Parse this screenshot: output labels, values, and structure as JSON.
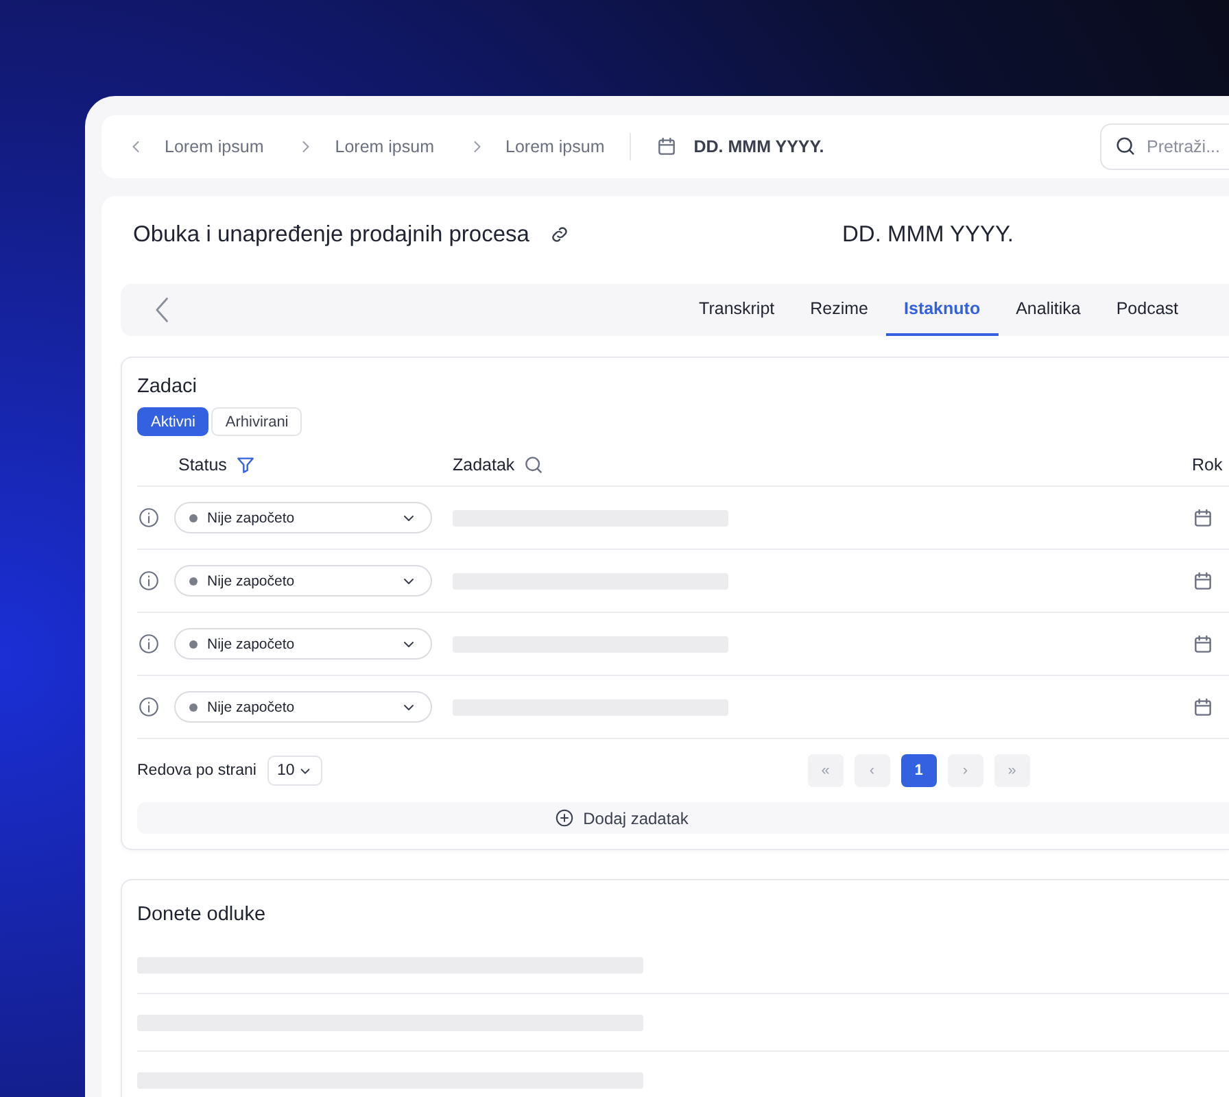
{
  "breadcrumbs": [
    {
      "label": "Lorem ipsum"
    },
    {
      "label": "Lorem ipsum"
    },
    {
      "label": "Lorem ipsum"
    }
  ],
  "breadcrumb_date": "DD. MMM YYYY.",
  "search": {
    "placeholder": "Pretraži..."
  },
  "page": {
    "title": "Obuka i unapređenje prodajnih procesa",
    "date": "DD. MMM YYYY."
  },
  "tabs": [
    {
      "label": "Transkript",
      "selected": false
    },
    {
      "label": "Rezime",
      "selected": false
    },
    {
      "label": "Istaknuto",
      "selected": true
    },
    {
      "label": "Analitika",
      "selected": false
    },
    {
      "label": "Podcast",
      "selected": false
    }
  ],
  "tasks": {
    "title": "Zadaci",
    "filters": [
      {
        "label": "Aktivni",
        "selected": true
      },
      {
        "label": "Arhivirani",
        "selected": false
      }
    ],
    "columns": [
      "Status",
      "Zadatak",
      "Rok"
    ],
    "rows": [
      {
        "status": "Nije započeto"
      },
      {
        "status": "Nije započeto"
      },
      {
        "status": "Nije započeto"
      },
      {
        "status": "Nije započeto"
      }
    ],
    "pagination": {
      "rows_label": "Redova po strani",
      "page_size": "10",
      "first": "«",
      "prev": "‹",
      "pages": [
        {
          "label": "1",
          "selected": true
        }
      ],
      "next": "›",
      "last": "»"
    },
    "add_button": "Dodaj zadatak"
  },
  "decisions": {
    "title": "Donete odluke"
  }
}
